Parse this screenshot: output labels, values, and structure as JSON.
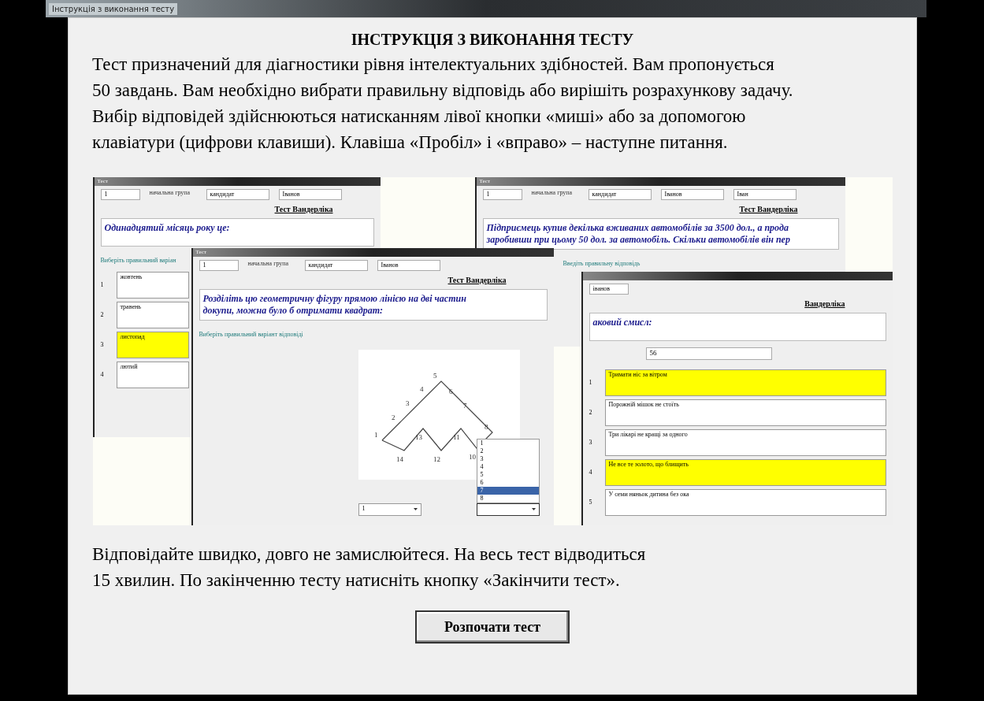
{
  "window": {
    "title": "Інструкція з виконання тесту"
  },
  "heading": "ІНСТРУКЦІЯ З ВИКОНАННЯ ТЕСТУ",
  "intro_lines": [
    "Тест призначений для діагностики рівня інтелектуальних здібностей. Вам пропонується",
    "50 завдань. Вам необхідно вибрати правильну відповідь або вирішіть розрахункову задачу.",
    "Вибір відповідей здійснюються натисканням лівої кнопки «миші» або за допомогою",
    "клавіатури (цифрови клавиши). Клавіша «Пробіл» і «вправо» – наступне питання."
  ],
  "collage": {
    "windows": [
      {
        "kind": "choice",
        "title": "Тест",
        "fields": [
          "1",
          "начальна група",
          "кандидат",
          "Іванов"
        ],
        "test_title": "Тест Вандерліка",
        "question_lines": [
          "Одинадцятий місяць року це:"
        ],
        "prompt": "Виберіть правильний варіан",
        "options": [
          {
            "number": "1",
            "text": "жовтень",
            "selected": false
          },
          {
            "number": "2",
            "text": "травень",
            "selected": false
          },
          {
            "number": "3",
            "text": "листопад",
            "selected": true
          },
          {
            "number": "4",
            "text": "лютий",
            "selected": false
          }
        ]
      },
      {
        "kind": "input",
        "title": "Тест",
        "fields": [
          "1",
          "начальна група",
          "кандидат",
          "Іванов",
          "Іван"
        ],
        "test_title": "Тест Вандерліка",
        "question_lines": [
          "Підприємець купив декілька вживаних автомобілів за 3500 дол., а прода",
          "заробивши при цьому 50 дол. за автомобіль. Скільки автомобілів він пер"
        ],
        "prompt": "Введіть правильну відповідь"
      },
      {
        "kind": "figure",
        "title": "Тест",
        "fields": [
          "1",
          "начальна група",
          "кандидат",
          "Іванов"
        ],
        "test_title": "Тест Вандерліка",
        "question_lines": [
          "Розділіть цю геометричну фігуру прямою лінією на дві частин",
          "докупи, можна було б отримати квадрат:"
        ],
        "prompt": "Виберіть правильний варіант відповіді",
        "figure_labels": [
          "1",
          "2",
          "3",
          "4",
          "5",
          "6",
          "7",
          "8",
          "10",
          "11",
          "12",
          "13",
          "14"
        ],
        "list": [
          {
            "text": "1",
            "selected": false
          },
          {
            "text": "2",
            "selected": false
          },
          {
            "text": "3",
            "selected": false
          },
          {
            "text": "4",
            "selected": false
          },
          {
            "text": "5",
            "selected": false
          },
          {
            "text": "6",
            "selected": false
          },
          {
            "text": "7",
            "selected": true
          },
          {
            "text": "8",
            "selected": false
          }
        ],
        "combos": [
          {
            "value": "1",
            "open": false
          },
          {
            "open": true
          }
        ]
      },
      {
        "kind": "proverbs",
        "fields": [
          "іванов"
        ],
        "test_title": "Вандерліка",
        "question_lines": [
          "аковий смисл:"
        ],
        "answer": "56",
        "options": [
          {
            "number": "1",
            "text": "Тримати ніс за вітром",
            "selected": true
          },
          {
            "number": "2",
            "text": "Порожній мішок не стоїть",
            "selected": false
          },
          {
            "number": "3",
            "text": "Три лікарі не кращі за одного",
            "selected": false
          },
          {
            "number": "4",
            "text": "Не все те золото, що блищить",
            "selected": true
          },
          {
            "number": "5",
            "text": "У семи няньок дитина без ока",
            "selected": false
          }
        ]
      }
    ]
  },
  "outro_lines": [
    "Відповідайте швидко, довго не замислюйтеся. На весь тест відводиться",
    "15  хвилин. По закінченню тесту натисніть кнопку «Закінчити тест»."
  ],
  "start_button": "Розпочати тест"
}
